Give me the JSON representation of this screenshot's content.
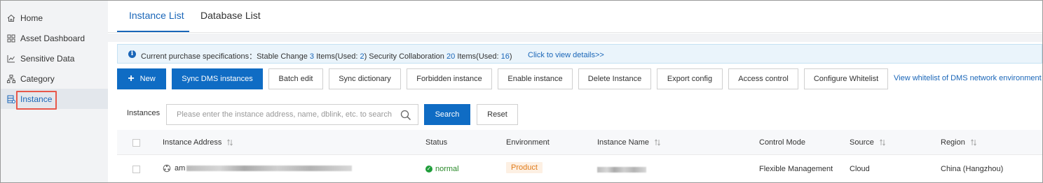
{
  "sidebar": {
    "items": [
      {
        "label": "Home",
        "icon": "home-icon"
      },
      {
        "label": "Asset Dashboard",
        "icon": "dashboard-icon"
      },
      {
        "label": "Sensitive Data",
        "icon": "chart-icon"
      },
      {
        "label": "Category",
        "icon": "hierarchy-icon"
      },
      {
        "label": "Instance",
        "icon": "database-icon",
        "active": true
      }
    ],
    "highlight_color": "#e8584a"
  },
  "tabs": [
    {
      "label": "Instance List",
      "active": true
    },
    {
      "label": "Database List",
      "active": false
    }
  ],
  "notice": {
    "prefix": "Current purchase specifications：Stable Change ",
    "stable_change_count": "3",
    "items_used_open": " Items(Used: ",
    "stable_change_used": "2",
    "close_and_security": ")  Security Collaboration ",
    "security_count": "20",
    "items_used_open_2": " Items(Used: ",
    "security_used": "16",
    "close": ")",
    "details_link": "Click to view details>>"
  },
  "toolbar": {
    "new_label": "New",
    "sync_dms_label": "Sync DMS instances",
    "batch_edit_label": "Batch edit",
    "sync_dictionary_label": "Sync dictionary",
    "forbidden_label": "Forbidden instance",
    "enable_label": "Enable instance",
    "delete_label": "Delete Instance",
    "export_label": "Export config",
    "access_control_label": "Access control",
    "configure_whitelist_label": "Configure Whitelist",
    "whitelist_link": "View whitelist of DMS network environment"
  },
  "search": {
    "label": "Instances",
    "placeholder": "Please enter the instance address, name, dblink, etc. to search",
    "value": "",
    "search_button": "Search",
    "reset_button": "Reset"
  },
  "table": {
    "headers": {
      "address": "Instance Address",
      "status": "Status",
      "environment": "Environment",
      "name": "Instance Name",
      "control_mode": "Control Mode",
      "source": "Source",
      "region": "Region"
    },
    "rows": [
      {
        "address_prefix": "am",
        "status": "normal",
        "environment": "Product",
        "control_mode": "Flexible Management",
        "source": "Cloud",
        "region": "China (Hangzhou)"
      }
    ]
  },
  "colors": {
    "primary": "#0f6cc4",
    "link": "#1a66b8",
    "status_ok": "#1f9d3a",
    "env_tag_text": "#e07b1a",
    "env_tag_bg": "#fdf0e3"
  }
}
